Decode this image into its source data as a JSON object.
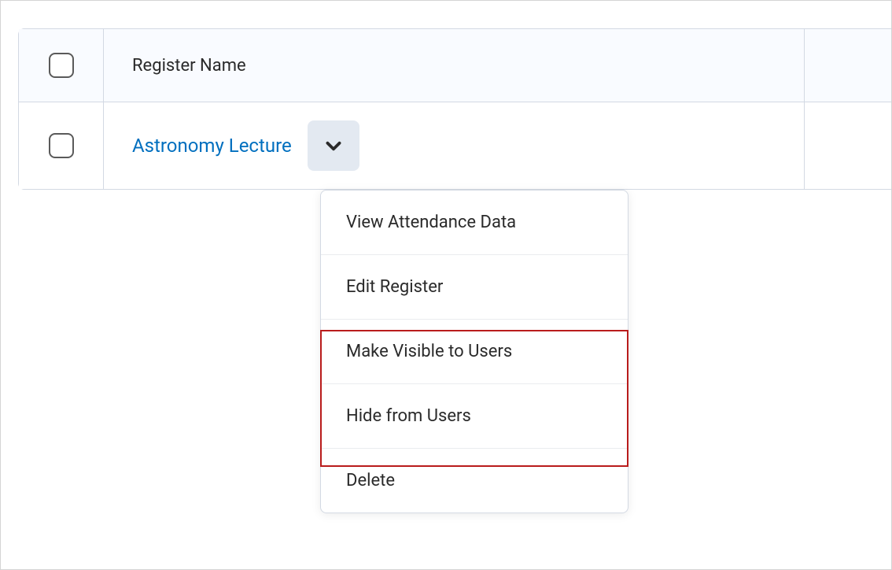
{
  "table": {
    "header": {
      "column_name": "Register Name"
    },
    "rows": [
      {
        "name": "Astronomy Lecture"
      }
    ]
  },
  "dropdown": {
    "items": [
      {
        "label": "View Attendance Data"
      },
      {
        "label": "Edit Register"
      },
      {
        "label": "Make Visible to Users"
      },
      {
        "label": "Hide from Users"
      },
      {
        "label": "Delete"
      }
    ]
  }
}
